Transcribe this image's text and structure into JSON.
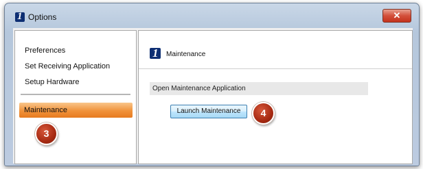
{
  "window": {
    "title": "Options",
    "close_label": "✕"
  },
  "sidebar": {
    "items": [
      {
        "label": "Preferences"
      },
      {
        "label": "Set Receiving Application"
      },
      {
        "label": "Setup Hardware"
      },
      {
        "label": "Maintenance",
        "selected": true
      }
    ]
  },
  "main": {
    "section_title": "Maintenance",
    "group_header": "Open Maintenance Application",
    "launch_button": "Launch Maintenance"
  },
  "callouts": [
    "3",
    "4"
  ],
  "colors": {
    "accent_selected": "#f0923a",
    "callout": "#a72a12",
    "logo": "#0e2f73"
  }
}
